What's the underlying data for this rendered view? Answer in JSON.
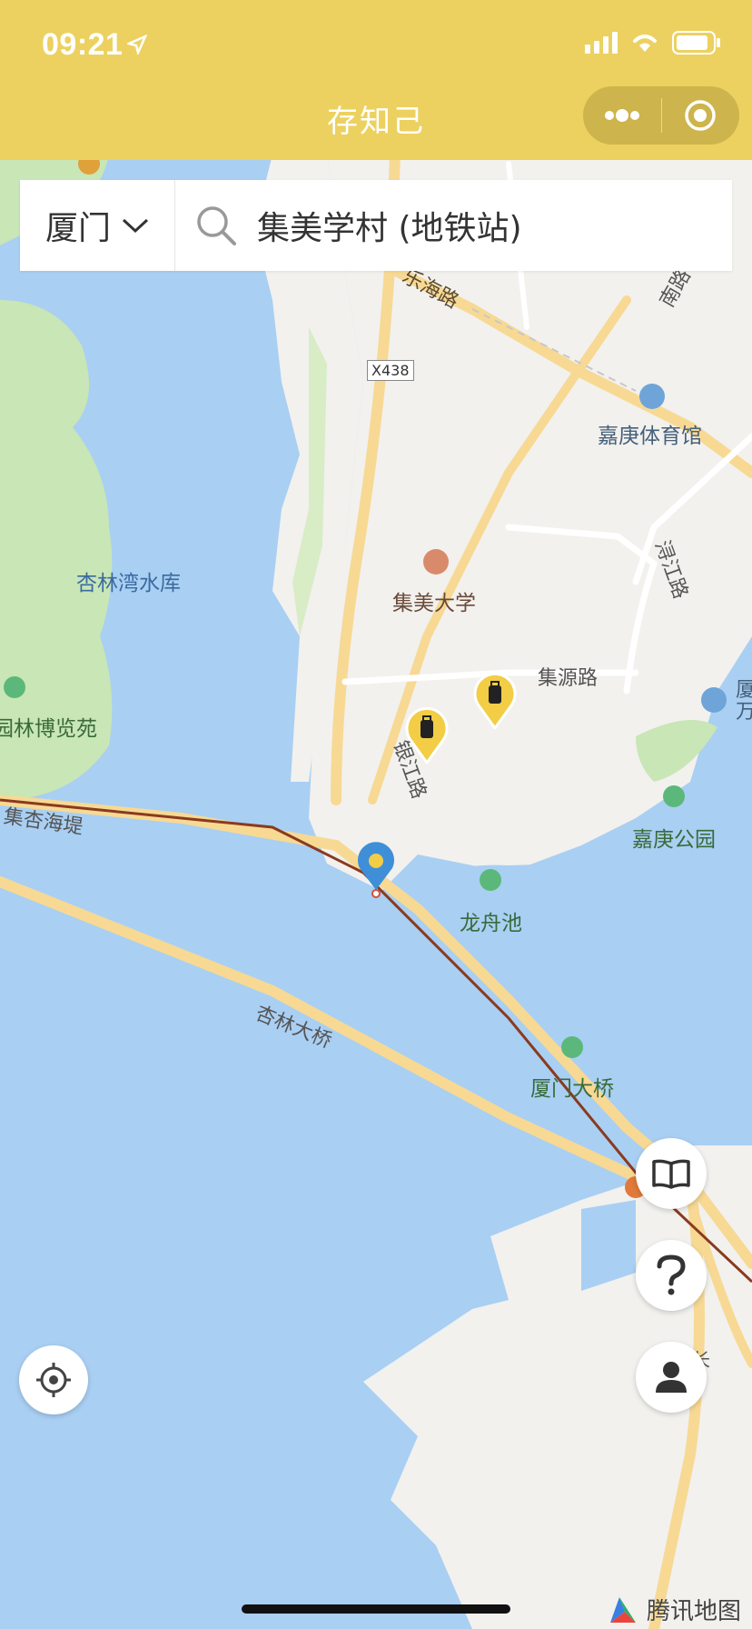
{
  "status_bar": {
    "time": "09:21"
  },
  "nav": {
    "title": "存知己"
  },
  "search": {
    "city": "厦门",
    "query": "集美学村 (地铁站)"
  },
  "map": {
    "road_labels": {
      "lehai": "乐海路",
      "x438": "X438",
      "jiyuan": "集源路",
      "xunjiang": "浔江路",
      "yinjiang": "银江路",
      "jixing_seawall": "集杏海堤",
      "xinglin_bridge": "杏林大桥",
      "xiamen_bridge": "厦门大桥",
      "nan": "南路",
      "chang": "长"
    },
    "poi_labels": {
      "stadium": "嘉庚体育馆",
      "university": "集美大学",
      "reservoir": "杏林湾水库",
      "expo_park": "园林博览苑",
      "jiageng_park": "嘉庚公园",
      "dragon_pool": "龙舟池",
      "hotel_edge": "厦\n万"
    },
    "watermark": "腾讯地图"
  },
  "icons": {
    "location": "location-arrow-icon",
    "signal": "signal-icon",
    "wifi": "wifi-icon",
    "battery": "battery-icon",
    "more": "more-dots-icon",
    "close": "target-close-icon",
    "chevron": "chevron-down-icon",
    "search": "search-icon",
    "book": "book-icon",
    "help": "question-icon",
    "user": "user-icon",
    "locate": "locate-icon"
  },
  "colors": {
    "header": "#ecd160",
    "water": "#a9cff3",
    "land": "#f2f1ee",
    "park": "#c8e6b6",
    "road": "#f7d994",
    "marker_blue": "#3e8fd8",
    "marker_yellow": "#f2cd45"
  }
}
